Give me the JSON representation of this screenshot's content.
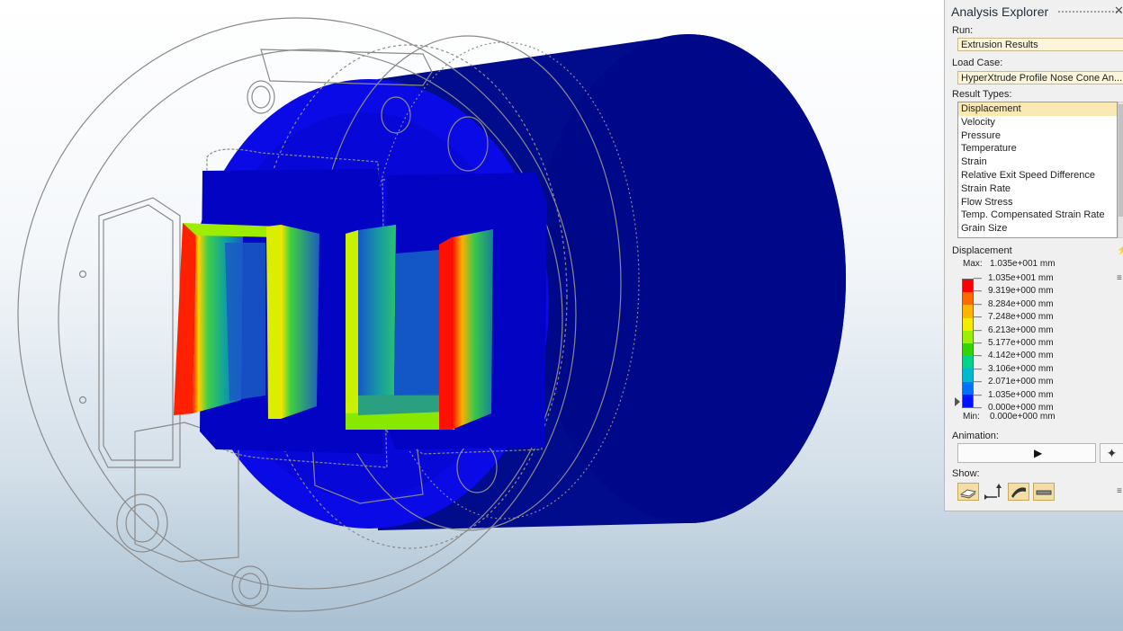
{
  "panel": {
    "title": "Analysis Explorer",
    "close_glyph": "✕",
    "run_label": "Run:",
    "run_value": "Extrusion Results",
    "load_case_label": "Load Case:",
    "load_case_value": "HyperXtrude Profile Nose Cone An...",
    "result_types_label": "Result Types:",
    "result_types": [
      "Displacement",
      "Velocity",
      "Pressure",
      "Temperature",
      "Strain",
      "Relative Exit Speed Difference",
      "Strain Rate",
      "Flow Stress",
      "Temp. Compensated Strain Rate",
      "Grain Size"
    ],
    "selected_result_index": 0,
    "legend": {
      "title": "Displacement",
      "max_label": "Max:",
      "max_value": "1.035e+001 mm",
      "min_label": "Min:",
      "min_value": "0.000e+000 mm",
      "values": [
        "1.035e+001 mm",
        "9.319e+000 mm",
        "8.284e+000 mm",
        "7.248e+000 mm",
        "6.213e+000 mm",
        "5.177e+000 mm",
        "4.142e+000 mm",
        "3.106e+000 mm",
        "2.071e+000 mm",
        "1.035e+000 mm",
        "0.000e+000 mm"
      ],
      "colors": [
        "#ff0000",
        "#ff6a00",
        "#ffb400",
        "#f4ec00",
        "#9cef00",
        "#34d400",
        "#00d48a",
        "#00b8d0",
        "#0070ff",
        "#0012ff"
      ]
    },
    "animation_label": "Animation:",
    "play_glyph": "▶",
    "anim_options_glyph": "✦",
    "show_label": "Show:",
    "show_buttons": [
      "deformed-shape-icon",
      "scale-arrow-icon",
      "contour-surface-icon",
      "flat-plate-icon"
    ],
    "menu_glyph": "≡"
  },
  "viewport": {
    "background_top": "#ffffff",
    "background_bottom": "#a9c0d2",
    "billet_color": "#000c8c",
    "die_face_color": "#0a0ae6",
    "outline_color": "#8a8a8a"
  }
}
